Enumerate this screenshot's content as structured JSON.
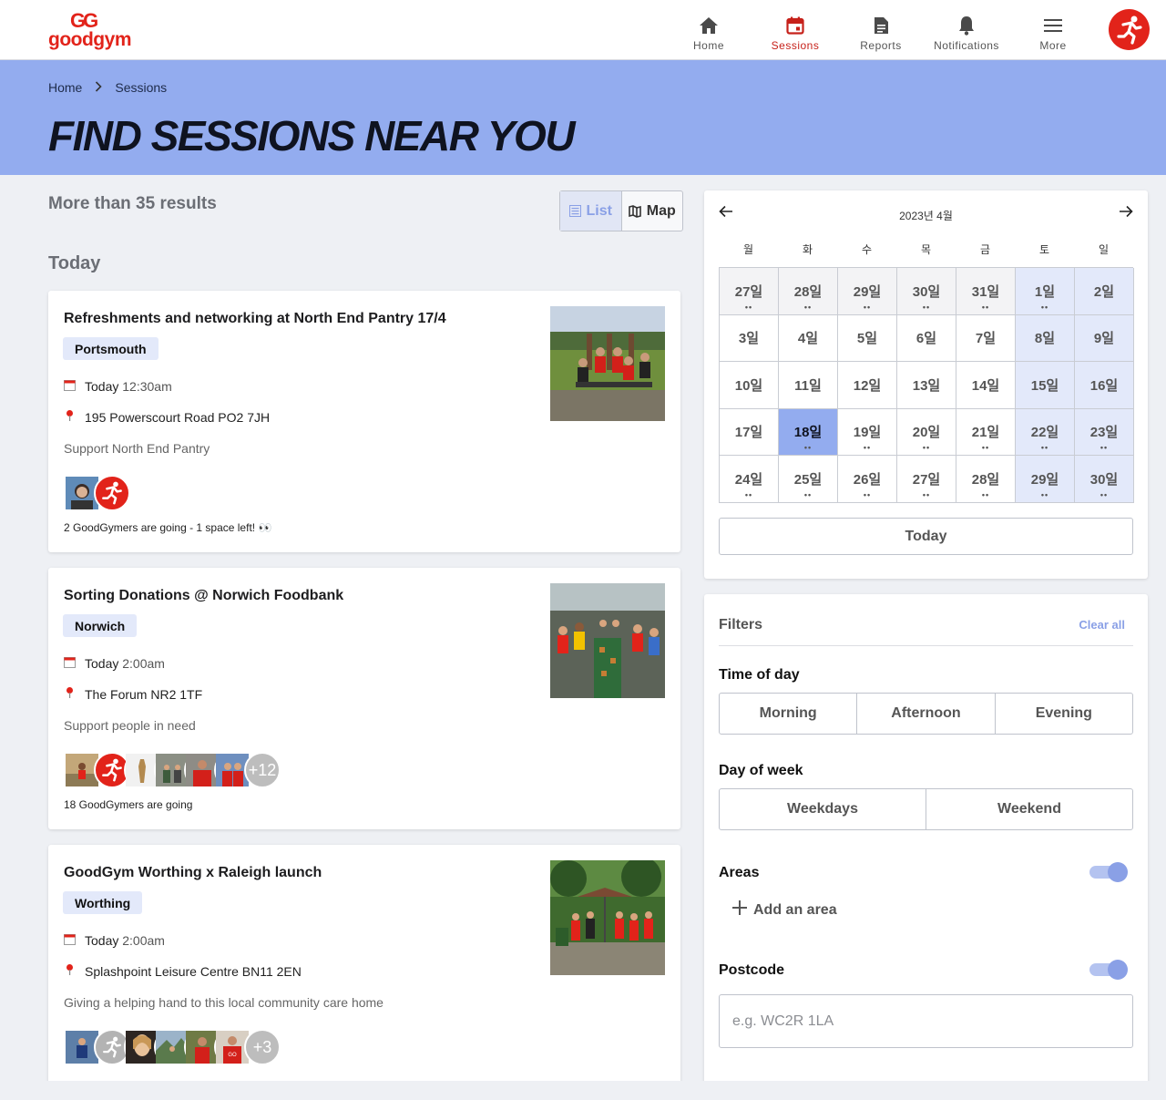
{
  "brand": {
    "mark": "GG",
    "name": "goodgym"
  },
  "nav": [
    {
      "label": "Home",
      "icon": "home-icon"
    },
    {
      "label": "Sessions",
      "icon": "calendar-icon",
      "active": true
    },
    {
      "label": "Reports",
      "icon": "document-icon"
    },
    {
      "label": "Notifications",
      "icon": "bell-icon"
    },
    {
      "label": "More",
      "icon": "menu-icon"
    }
  ],
  "breadcrumb": {
    "home": "Home",
    "current": "Sessions"
  },
  "page_title": "FIND SESSIONS NEAR YOU",
  "results_text": "More than 35 results",
  "view_toggle": {
    "list": "List",
    "map": "Map"
  },
  "section_today": "Today",
  "sessions": [
    {
      "title": "Refreshments and networking at North End Pantry 17/4",
      "area": "Portsmouth",
      "day": "Today",
      "time": "12:30am",
      "address": "195 Powerscourt Road PO2 7JH",
      "description": "Support North End Pantry",
      "going": "2 GoodGymers are going - 1 space left! 👀"
    },
    {
      "title": "Sorting Donations @ Norwich Foodbank",
      "area": "Norwich",
      "day": "Today",
      "time": "2:00am",
      "address": "The Forum NR2 1TF",
      "description": "Support people in need",
      "extra_count": "+12",
      "going": "18 GoodGymers are going"
    },
    {
      "title": "GoodGym Worthing x Raleigh launch",
      "area": "Worthing",
      "day": "Today",
      "time": "2:00am",
      "address": "Splashpoint Leisure Centre BN11 2EN",
      "description": "Giving a helping hand to this local community care home",
      "extra_count": "+3"
    }
  ],
  "calendar": {
    "month_label": "2023년 4월",
    "weekdays": [
      "월",
      "화",
      "수",
      "목",
      "금",
      "토",
      "일"
    ],
    "weeks": [
      [
        "27일",
        "28일",
        "29일",
        "30일",
        "31일",
        "1일",
        "2일"
      ],
      [
        "3일",
        "4일",
        "5일",
        "6일",
        "7일",
        "8일",
        "9일"
      ],
      [
        "10일",
        "11일",
        "12일",
        "13일",
        "14일",
        "15일",
        "16일"
      ],
      [
        "17일",
        "18일",
        "19일",
        "20일",
        "21일",
        "22일",
        "23일"
      ],
      [
        "24일",
        "25일",
        "26일",
        "27일",
        "28일",
        "29일",
        "30일"
      ]
    ],
    "selected": "18일",
    "dots": "••",
    "today_button": "Today"
  },
  "filters": {
    "title": "Filters",
    "clear_all": "Clear all",
    "time_of_day": {
      "label": "Time of day",
      "options": [
        "Morning",
        "Afternoon",
        "Evening"
      ]
    },
    "day_of_week": {
      "label": "Day of week",
      "options": [
        "Weekdays",
        "Weekend"
      ]
    },
    "areas": {
      "label": "Areas",
      "add": "Add an area",
      "enabled": true
    },
    "postcode": {
      "label": "Postcode",
      "placeholder": "e.g. WC2R 1LA",
      "enabled": true
    }
  },
  "colors": {
    "brand_red": "#e2231a",
    "hero_blue": "#93acef",
    "accent": "#8aa0e6",
    "weekend_bg": "#e3e9fa"
  }
}
